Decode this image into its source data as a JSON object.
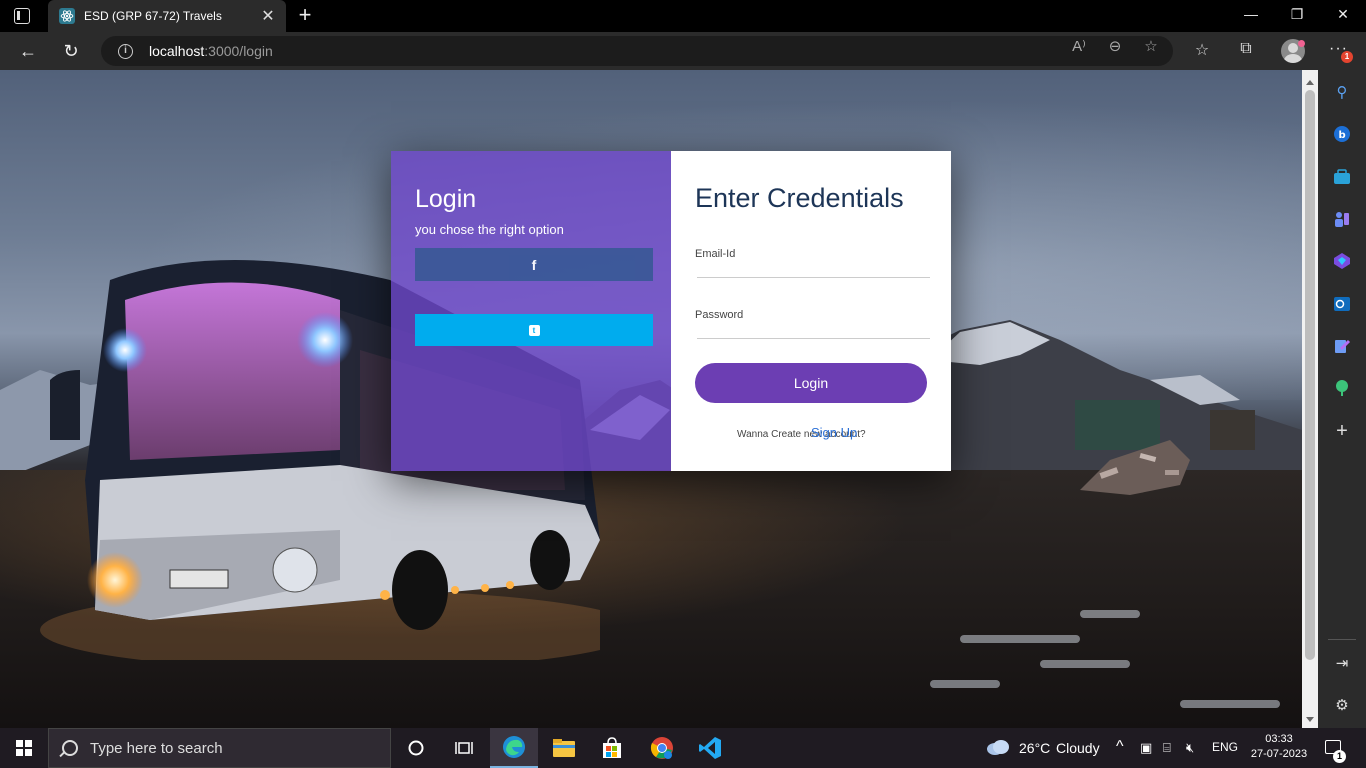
{
  "browser": {
    "tab_title": "ESD (GRP 67-72) Travels",
    "tab_close": "✕",
    "new_tab": "+",
    "window_controls": {
      "minimize": "—",
      "maximize": "❐",
      "close": "✕"
    },
    "nav": {
      "back": "←",
      "refresh": "↻",
      "more": "···"
    },
    "url_host": "localhost",
    "url_path": ":3000/login",
    "profile_badge": "1"
  },
  "login_panel": {
    "title": "Login",
    "subtitle": "you chose the right option",
    "facebook_glyph": "f",
    "twitter_glyph": "t",
    "facebook_color": "#3b5998",
    "twitter_color": "#00acee"
  },
  "credentials": {
    "heading": "Enter Credentials",
    "email_label": "Email-Id",
    "email_value": "",
    "password_label": "Password",
    "password_value": "",
    "login_button": "Login",
    "signup_prompt": "Wanna Create new account?",
    "signup_link": "Sign Up",
    "accent_color": "#6c3eb3"
  },
  "taskbar": {
    "search_placeholder": "Type here to search",
    "weather_temp": "26°C",
    "weather_desc": "Cloudy",
    "language": "ENG",
    "time": "03:33",
    "date": "27-07-2023",
    "notification_count": "1",
    "tray_chevron": "^"
  }
}
